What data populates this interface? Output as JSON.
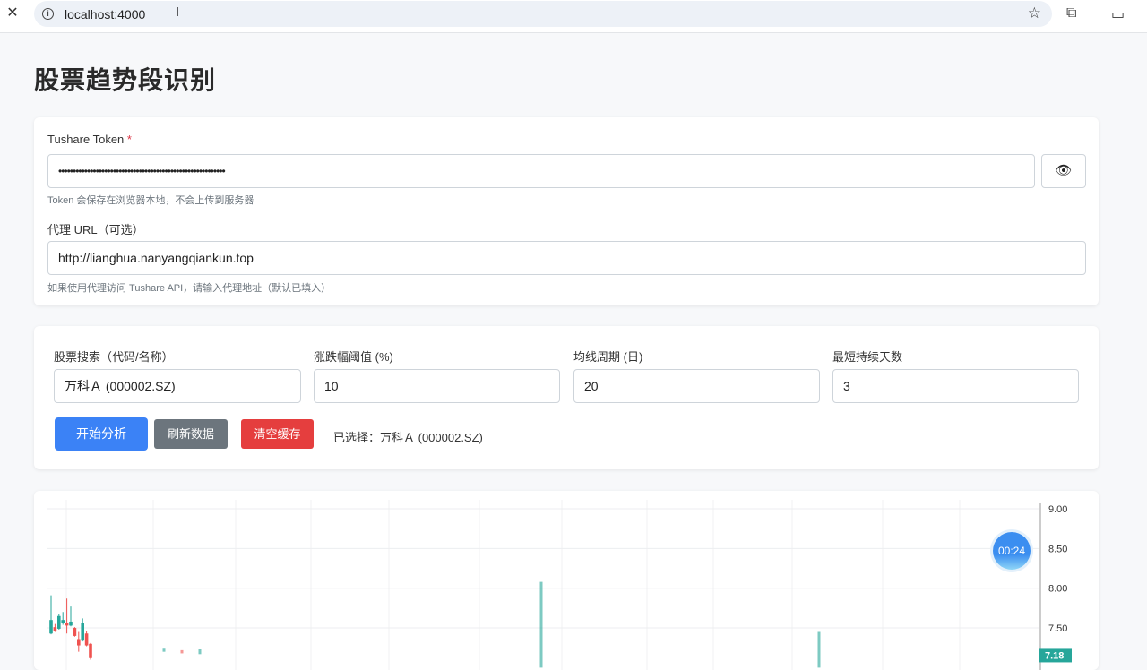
{
  "browser": {
    "url": "localhost:4000"
  },
  "page": {
    "title": "股票趋势段识别"
  },
  "config": {
    "token_label": "Tushare Token",
    "required_mark": "*",
    "token_value": "••••••••••••••••••••••••••••••••••••••••••••••••••••••••••",
    "token_hint": "Token 会保存在浏览器本地，不会上传到服务器",
    "proxy_label": "代理 URL（可选）",
    "proxy_value": "http://lianghua.nanyangqiankun.top",
    "proxy_hint": "如果使用代理访问 Tushare API，请输入代理地址（默认已填入）"
  },
  "params": {
    "stock_label": "股票搜索（代码/名称）",
    "stock_value": "万科Ａ (000002.SZ)",
    "threshold_label": "涨跌幅阈值 (%)",
    "threshold_value": "10",
    "ma_label": "均线周期 (日)",
    "ma_value": "20",
    "min_days_label": "最短持续天数",
    "min_days_value": "3",
    "analyze_button": "开始分析",
    "refresh_button": "刷新数据",
    "clear_button": "清空缓存",
    "selected_text": "已选择：万科Ａ (000002.SZ)"
  },
  "colors": {
    "primary": "#3b82f6",
    "secondary": "#6c757d",
    "danger": "#e53e3e",
    "up": "#26a69a",
    "down": "#ef5350"
  },
  "timer": "00:24",
  "chart_data": {
    "type": "candlestick",
    "y_ticks": [
      "9.00",
      "8.50",
      "8.00",
      "7.50"
    ],
    "ylim": [
      7.18,
      9.0
    ],
    "last_price": "7.18",
    "candles": [
      {
        "o": 7.43,
        "h": 7.91,
        "l": 7.42,
        "c": 7.6
      },
      {
        "o": 7.51,
        "h": 7.55,
        "l": 7.45,
        "c": 7.46
      },
      {
        "o": 7.49,
        "h": 7.67,
        "l": 7.48,
        "c": 7.65
      },
      {
        "o": 7.56,
        "h": 7.7,
        "l": 7.54,
        "c": 7.6
      },
      {
        "o": 7.56,
        "h": 7.87,
        "l": 7.43,
        "c": 7.53
      },
      {
        "o": 7.53,
        "h": 7.77,
        "l": 7.52,
        "c": 7.58
      },
      {
        "o": 7.5,
        "h": 7.51,
        "l": 7.39,
        "c": 7.4
      },
      {
        "o": 7.36,
        "h": 7.45,
        "l": 7.2,
        "c": 7.28
      },
      {
        "o": 7.34,
        "h": 7.62,
        "l": 7.33,
        "c": 7.56
      },
      {
        "o": 7.43,
        "h": 7.46,
        "l": 7.27,
        "c": 7.28
      },
      {
        "o": 7.3,
        "h": 7.31,
        "l": 7.1,
        "c": 7.12
      }
    ]
  }
}
